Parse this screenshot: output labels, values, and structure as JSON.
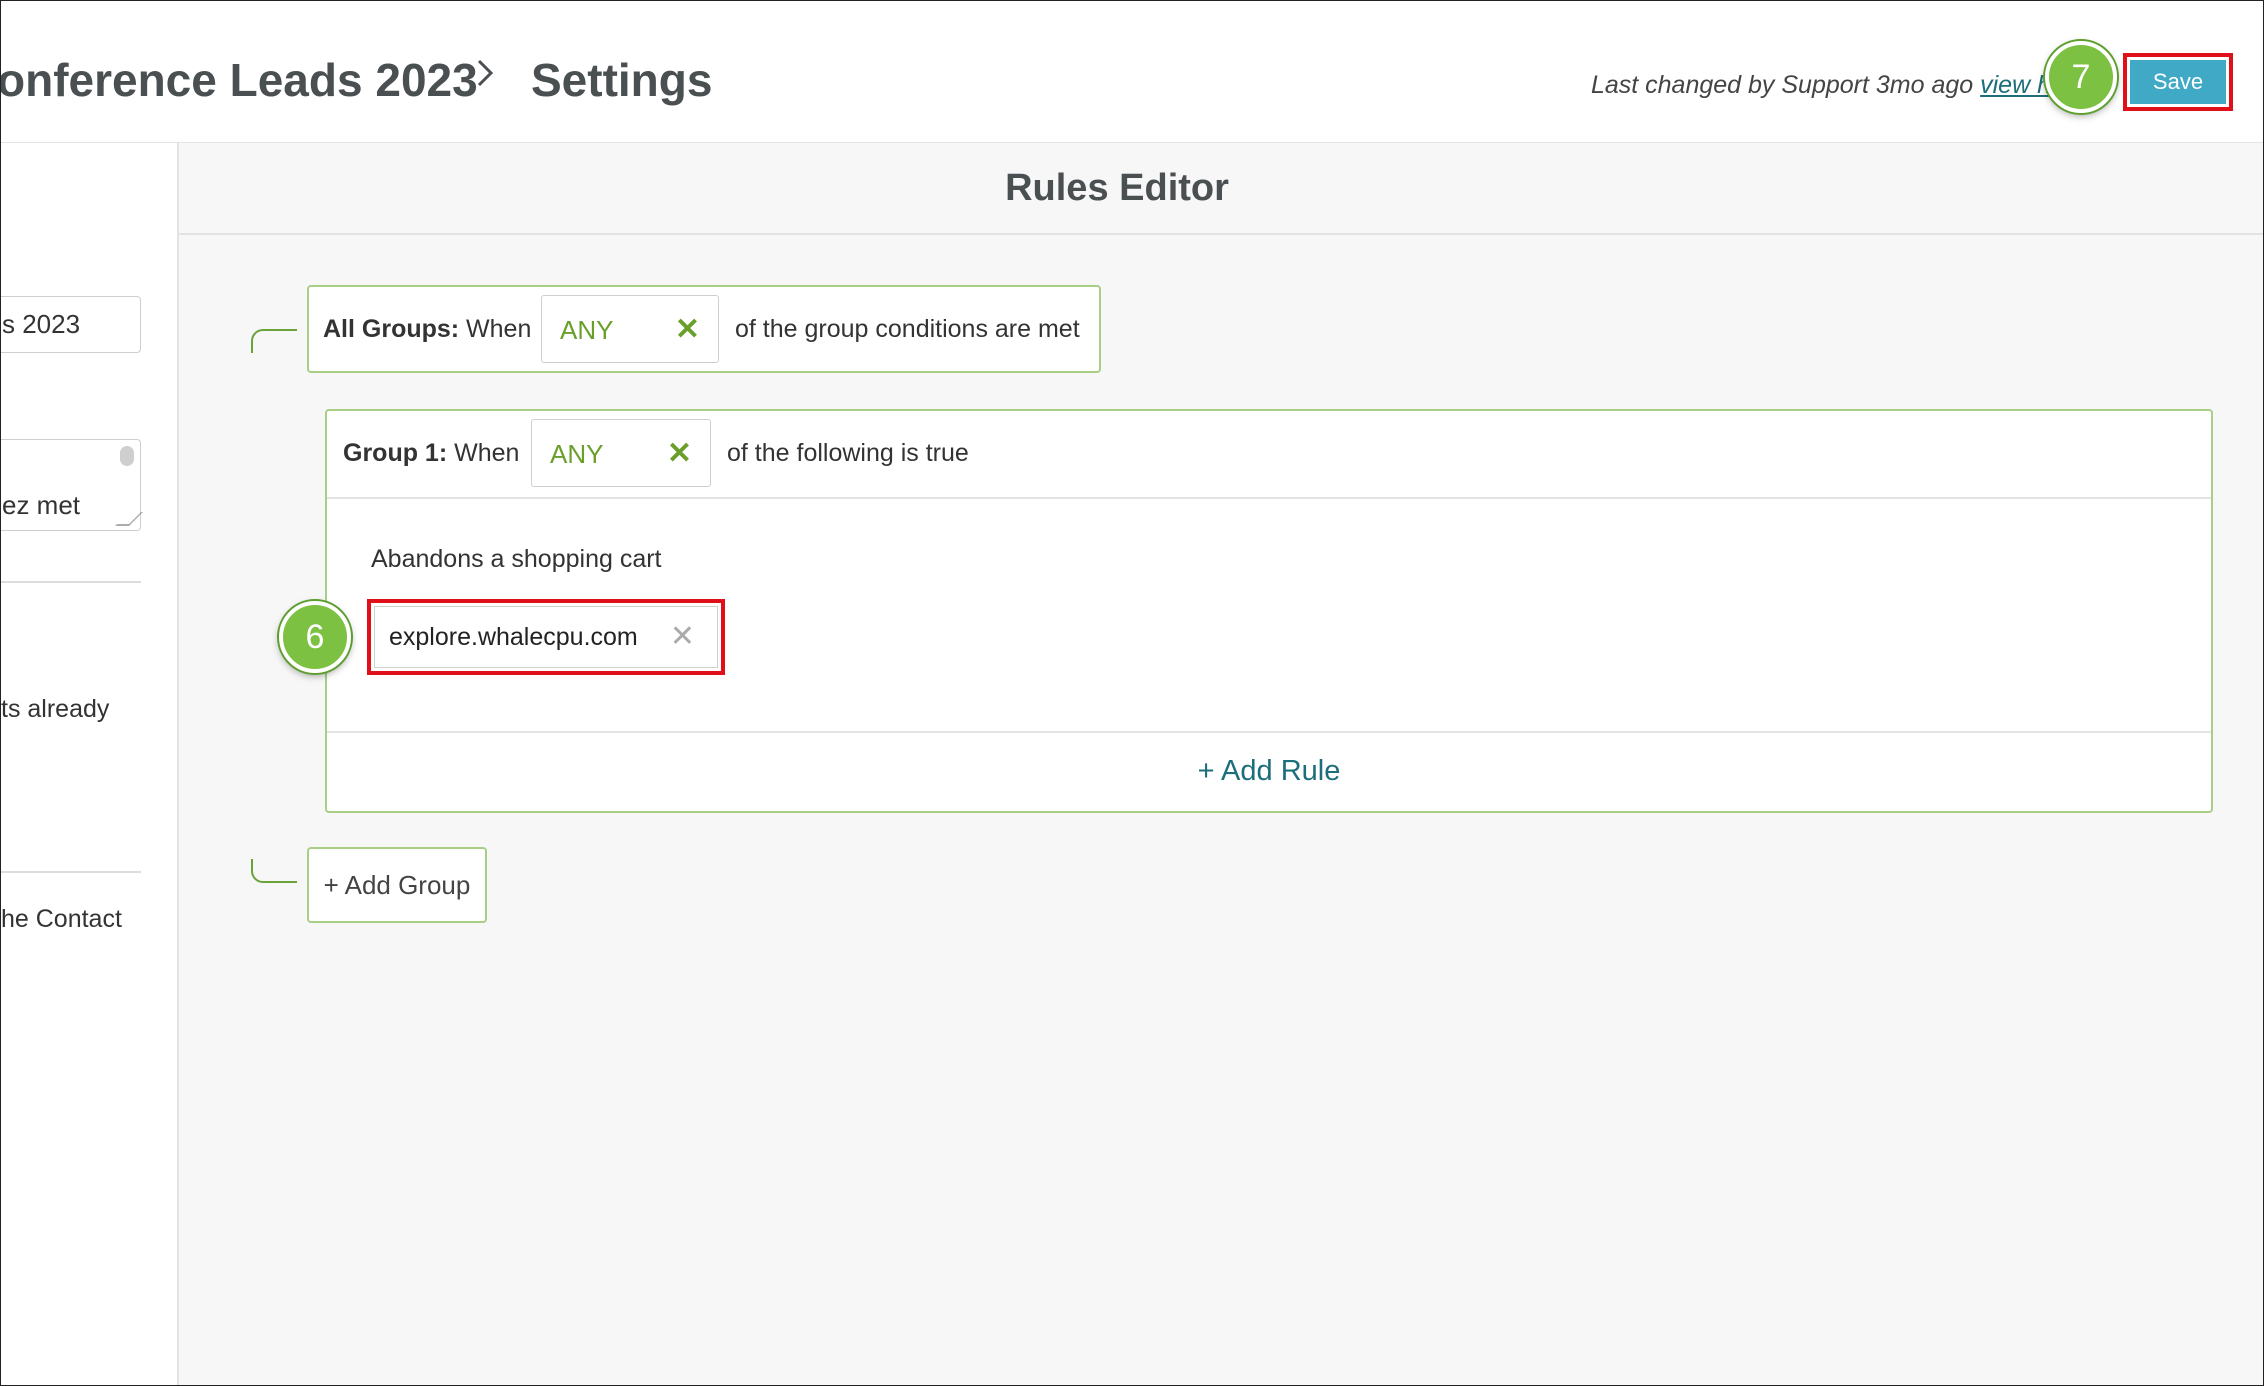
{
  "header": {
    "breadcrumb_parent": "onference Leads 2023",
    "breadcrumb_current": "Settings",
    "last_changed_prefix": "Last changed by Support 3mo ago ",
    "last_changed_link": "view h",
    "save_label": "Save",
    "step_badge": "7"
  },
  "sidebar": {
    "name_value": "s 2023",
    "description_value": "ez met",
    "text_1": "ts already",
    "text_2": "he Contact"
  },
  "rules_editor": {
    "title": "Rules Editor",
    "all_groups": {
      "label_bold": "All Groups:",
      "label_when": " When",
      "selector_value": "ANY",
      "suffix": "of the group conditions are met"
    },
    "groups": [
      {
        "label_bold": "Group 1:",
        "label_when": " When",
        "selector_value": "ANY",
        "suffix": "of the following is true",
        "rule_label": "Abandons a shopping cart",
        "rule_value": "explore.whalecpu.com",
        "step_badge": "6",
        "add_rule_label": "+ Add Rule"
      }
    ],
    "add_group_label": "+ Add Group"
  },
  "colors": {
    "accent_green": "#6a9f2b",
    "save_button": "#3fa9c6",
    "highlight_red": "#e0101a",
    "badge_green": "#7cc142",
    "link_teal": "#1c6e7a"
  }
}
